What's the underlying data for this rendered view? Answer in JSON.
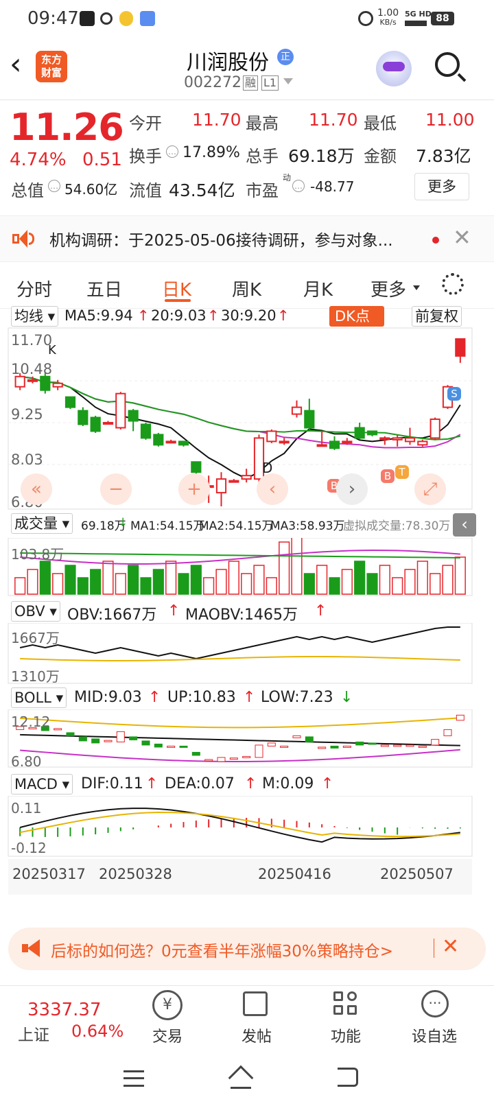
{
  "statusbar": {
    "time": "09:47",
    "net_speed": "1.00",
    "net_unit": "KB/s",
    "net_type": "5G HD",
    "battery": "88"
  },
  "header": {
    "app_logo_line1": "东方",
    "app_logo_line2": "财富",
    "stock_name": "川润股份",
    "stock_code": "002272",
    "tag_margin": "融",
    "tag_level": "L1",
    "cert_badge": "正"
  },
  "quote": {
    "price": "11.26",
    "change_pct": "4.74%",
    "change_abs": "0.51",
    "open_label": "今开",
    "open": "11.70",
    "high_label": "最高",
    "high": "11.70",
    "low_label": "最低",
    "low": "11.00",
    "turnover_label": "换手",
    "turnover": "17.89%",
    "volume_label": "总手",
    "volume": "69.18万",
    "amount_label": "金额",
    "amount": "7.83亿",
    "mktcap_label": "总值",
    "mktcap": "54.60亿",
    "float_label": "流值",
    "float": "43.54亿",
    "pe_label": "市盈",
    "pe_sup": "动",
    "pe": "-48.77",
    "more_label": "更多"
  },
  "notice": {
    "text": "机构调研：于2025-05-06接待调研，参与对象..."
  },
  "tabs": [
    "分时",
    "五日",
    "日K",
    "周K",
    "月K",
    "更多"
  ],
  "active_tab": "日K",
  "kline": {
    "selector": "均线",
    "ma5": "MA5:9.94",
    "ma20": "20:9.03",
    "ma30": "30:9.20",
    "dk_label": "DK点",
    "adjust": "前复权",
    "y_labels": [
      "11.70",
      "10.48",
      "9.25",
      "8.03",
      "6.80"
    ],
    "marker_d": "D",
    "marker_b": "B",
    "marker_t": "T",
    "marker_s": "S",
    "marker_k": "K"
  },
  "volume": {
    "selector": "成交量",
    "vol": "69.18万",
    "ma1": "MA1:54.15万",
    "ma2": "MA2:54.15万",
    "ma3": "MA3:58.93万",
    "virtual": "虚拟成交量:78.30万",
    "ymax": "103.8万"
  },
  "obv": {
    "selector": "OBV",
    "obv": "OBV:1667万",
    "maobv": "MAOBV:1465万",
    "y_top": "1667万",
    "y_bottom": "1310万"
  },
  "boll": {
    "selector": "BOLL",
    "mid": "MID:9.03",
    "up": "UP:10.83",
    "low": "LOW:7.23",
    "y_top": "12.12",
    "y_bottom": "6.80"
  },
  "macd": {
    "selector": "MACD",
    "dif": "DIF:0.11",
    "dea": "DEA:0.07",
    "m": "M:0.09",
    "y_top": "0.11",
    "y_bottom": "-0.12"
  },
  "dates": [
    "20250317",
    "20250328",
    "20250416",
    "20250507"
  ],
  "ad": {
    "text": "后标的如何选？0元查看半年涨幅30%策略持仓>"
  },
  "bottomnav": {
    "index_value": "3337.37",
    "index_name": "上证",
    "index_change": "0.64%",
    "trade": "交易",
    "post": "发帖",
    "func": "功能",
    "watch": "设自选"
  },
  "colors": {
    "up": "#e4262b",
    "down": "#1a9c1a",
    "accent": "#f05a24",
    "ma20": "#c630c6",
    "ma30": "#1a9c1a",
    "gold": "#e7b400"
  },
  "chart_data": {
    "type": "candlestick",
    "ylim": [
      6.8,
      11.7
    ],
    "candles": [
      {
        "o": 10.3,
        "c": 10.6,
        "h": 10.7,
        "l": 10.2
      },
      {
        "o": 10.5,
        "c": 10.5,
        "h": 10.6,
        "l": 10.4
      },
      {
        "o": 10.6,
        "c": 10.2,
        "h": 10.7,
        "l": 10.1
      },
      {
        "o": 10.3,
        "c": 10.4,
        "h": 10.5,
        "l": 10.2
      },
      {
        "o": 10.0,
        "c": 9.7,
        "h": 10.0,
        "l": 9.65
      },
      {
        "o": 9.6,
        "c": 9.2,
        "h": 9.7,
        "l": 9.15
      },
      {
        "o": 9.4,
        "c": 9.0,
        "h": 9.45,
        "l": 8.95
      },
      {
        "o": 9.25,
        "c": 9.25,
        "h": 9.3,
        "l": 9.2
      },
      {
        "o": 9.1,
        "c": 10.1,
        "h": 10.15,
        "l": 9.05
      },
      {
        "o": 9.6,
        "c": 9.3,
        "h": 9.65,
        "l": 9.0
      },
      {
        "o": 9.2,
        "c": 8.8,
        "h": 9.25,
        "l": 8.75
      },
      {
        "o": 8.9,
        "c": 8.6,
        "h": 8.95,
        "l": 8.55
      },
      {
        "o": 8.7,
        "c": 8.7,
        "h": 8.75,
        "l": 8.65
      },
      {
        "o": 8.7,
        "c": 8.6,
        "h": 8.7,
        "l": 8.55
      },
      {
        "o": 8.1,
        "c": 7.8,
        "h": 8.1,
        "l": 7.75
      },
      {
        "o": 7.4,
        "c": 7.4,
        "h": 7.7,
        "l": 6.9
      },
      {
        "o": 7.2,
        "c": 7.6,
        "h": 7.8,
        "l": 6.8
      },
      {
        "o": 7.55,
        "c": 7.55,
        "h": 7.6,
        "l": 7.5
      },
      {
        "o": 7.6,
        "c": 7.7,
        "h": 7.9,
        "l": 7.5
      },
      {
        "o": 7.6,
        "c": 8.8,
        "h": 8.9,
        "l": 7.5
      },
      {
        "o": 8.7,
        "c": 9.0,
        "h": 9.05,
        "l": 8.65
      },
      {
        "o": 8.7,
        "c": 8.7,
        "h": 8.8,
        "l": 8.6
      },
      {
        "o": 9.5,
        "c": 9.7,
        "h": 9.9,
        "l": 9.4
      },
      {
        "o": 9.6,
        "c": 9.1,
        "h": 9.95,
        "l": 9.05
      },
      {
        "o": 8.6,
        "c": 8.6,
        "h": 9.0,
        "l": 8.55
      },
      {
        "o": 8.7,
        "c": 8.5,
        "h": 8.85,
        "l": 8.45
      },
      {
        "o": 8.7,
        "c": 8.7,
        "h": 8.8,
        "l": 8.6
      },
      {
        "o": 9.1,
        "c": 8.8,
        "h": 9.25,
        "l": 8.75
      },
      {
        "o": 9.0,
        "c": 8.9,
        "h": 9.0,
        "l": 8.85
      },
      {
        "o": 8.8,
        "c": 8.8,
        "h": 8.85,
        "l": 8.6
      },
      {
        "o": 8.75,
        "c": 8.8,
        "h": 8.9,
        "l": 8.55
      },
      {
        "o": 8.7,
        "c": 8.8,
        "h": 9.1,
        "l": 8.6
      },
      {
        "o": 8.6,
        "c": 8.7,
        "h": 8.75,
        "l": 8.55
      },
      {
        "o": 8.8,
        "c": 9.35,
        "h": 9.4,
        "l": 8.75
      },
      {
        "o": 9.7,
        "c": 10.3,
        "h": 10.35,
        "l": 9.65
      },
      {
        "o": 11.2,
        "c": 11.7,
        "h": 11.7,
        "l": 11.0
      }
    ]
  }
}
